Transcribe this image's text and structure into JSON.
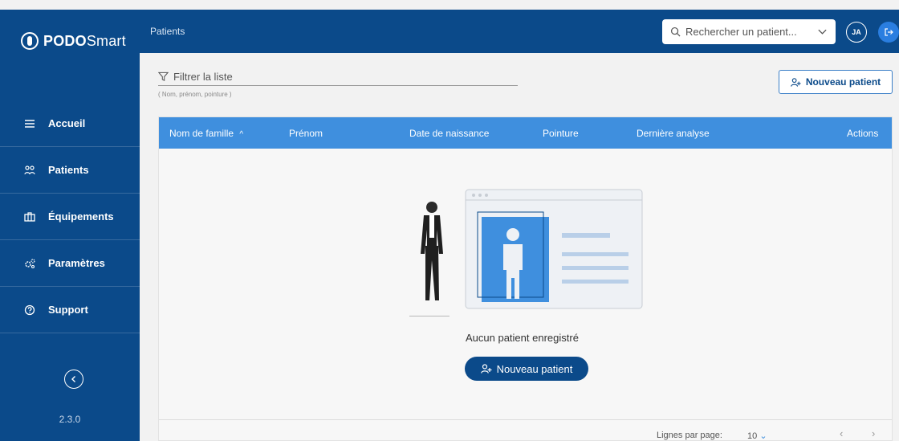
{
  "app": {
    "logo_bold": "PODO",
    "logo_light": "Smart",
    "version": "2.3.0"
  },
  "header": {
    "breadcrumb": "Patients",
    "search_placeholder": "Rechercher un patient...",
    "avatar_initials": "JA"
  },
  "sidebar": {
    "items": [
      {
        "label": "Accueil",
        "icon": "menu-icon"
      },
      {
        "label": "Patients",
        "icon": "users-icon"
      },
      {
        "label": "Équipements",
        "icon": "briefcase-icon"
      },
      {
        "label": "Paramètres",
        "icon": "gears-icon"
      },
      {
        "label": "Support",
        "icon": "help-icon"
      }
    ]
  },
  "filter": {
    "placeholder": "Filtrer la liste",
    "hint": "( Nom, prénom, pointure )"
  },
  "toolbar": {
    "new_patient_label": "Nouveau patient"
  },
  "table": {
    "columns": [
      "Nom de famille",
      "Prénom",
      "Date de naissance",
      "Pointure",
      "Dernière analyse",
      "Actions"
    ],
    "sort_indicator": "^",
    "empty_text": "Aucun patient enregistré",
    "empty_button": "Nouveau patient",
    "rows_per_page_label": "Lignes par page:",
    "rows_per_page_value": "10"
  },
  "colors": {
    "primary": "#0b4a8a",
    "header_blue": "#3f8fde",
    "accent": "#2a7ee0"
  }
}
